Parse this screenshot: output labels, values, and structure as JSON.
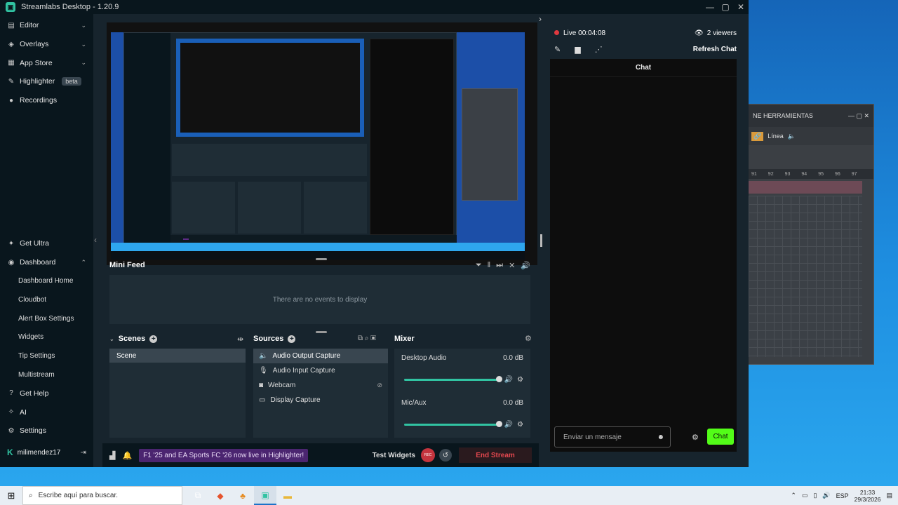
{
  "window": {
    "title": "Streamlabs Desktop - 1.20.9",
    "logo": "streamlabs-logo-icon"
  },
  "sidebar": {
    "top_items": [
      {
        "label": "Editor",
        "icon": "editor-icon"
      },
      {
        "label": "Overlays",
        "icon": "overlays-icon"
      },
      {
        "label": "App Store",
        "icon": "app-store-icon"
      },
      {
        "label": "Highlighter",
        "icon": "highlighter-icon",
        "badge": "beta"
      },
      {
        "label": "Recordings",
        "icon": "recordings-icon"
      }
    ],
    "bottom_items": [
      {
        "label": "Get Ultra"
      },
      {
        "label": "Dashboard"
      }
    ],
    "dashboard_sub": [
      "Dashboard Home",
      "Cloudbot",
      "Alert Box Settings",
      "Widgets",
      "Tip Settings",
      "Multistream"
    ],
    "extra_items": [
      {
        "label": "Get Help"
      },
      {
        "label": "AI"
      },
      {
        "label": "Settings"
      }
    ],
    "user": "milimendez17"
  },
  "minifeed": {
    "title": "Mini Feed",
    "empty": "There are no events to display"
  },
  "scenes": {
    "title": "Scenes",
    "items": [
      "Scene"
    ]
  },
  "sources": {
    "title": "Sources",
    "items": [
      "Audio Output Capture",
      "Audio Input Capture",
      "Webcam",
      "Display Capture"
    ]
  },
  "mixer": {
    "title": "Mixer",
    "channels": [
      {
        "name": "Desktop Audio",
        "db": "0.0 dB"
      },
      {
        "name": "Mic/Aux",
        "db": "0.0 dB"
      }
    ]
  },
  "footer": {
    "banner": "F1 '25 and EA Sports FC '26 now live in Highlighter!",
    "test_widgets": "Test Widgets",
    "end_stream": "End Stream"
  },
  "live": {
    "status": "Live",
    "time": "00:04:08",
    "viewers": "2 viewers",
    "refresh": "Refresh Chat"
  },
  "chat": {
    "title": "Chat",
    "placeholder": "Enviar un mensaje",
    "send": "Chat"
  },
  "taskbar": {
    "search": "Escribe aquí para buscar.",
    "lang": "ESP",
    "time": "21:33",
    "date": "29/3/2026"
  },
  "background_window": {
    "title": "NE HERRAMIENTAS",
    "mode": "Línea",
    "ruler": [
      "91",
      "92",
      "93",
      "94",
      "95",
      "96",
      "97"
    ]
  },
  "colors": {
    "accent": "#31c3a2",
    "live": "#e0393f",
    "send": "#53fc18",
    "end_stream": "#e4484f"
  }
}
